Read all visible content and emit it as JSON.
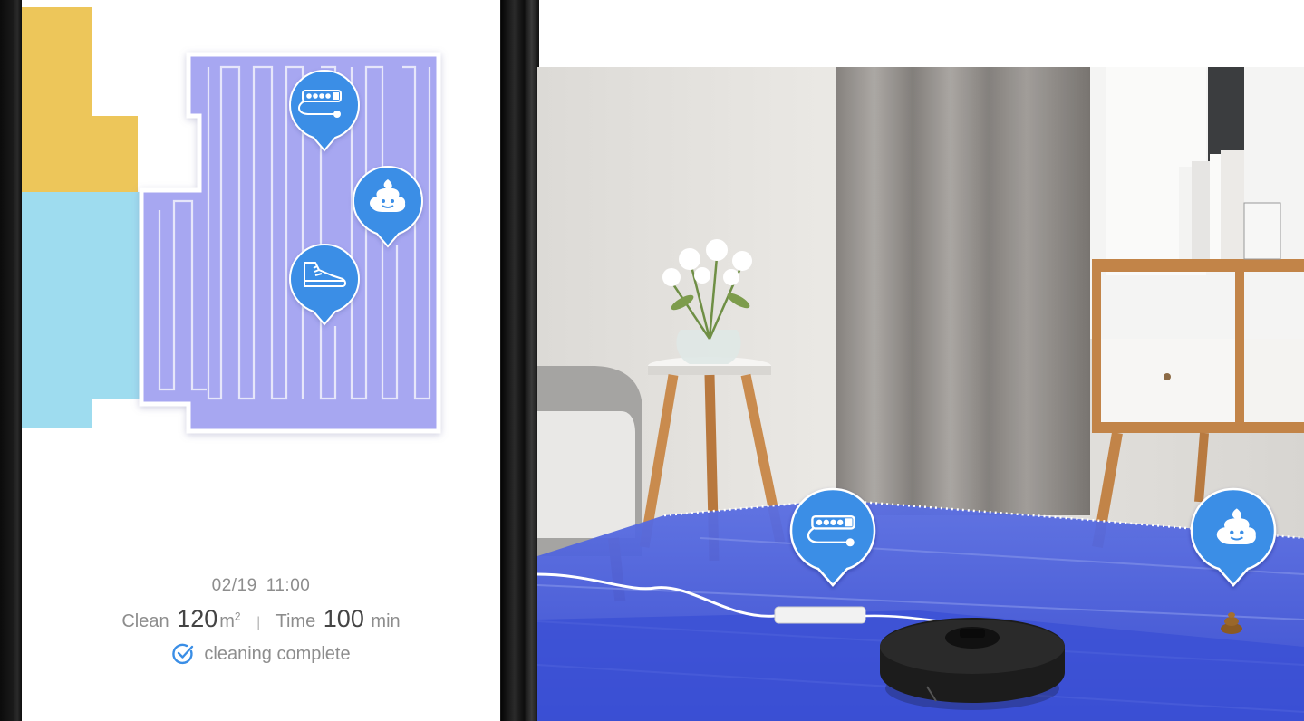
{
  "app_screen": {
    "date": "02/19",
    "time": "11:00",
    "clean_label": "Clean",
    "clean_value": "120",
    "clean_unit": "m",
    "clean_unit_sup": "2",
    "separator": "|",
    "time_label": "Time",
    "time_value": "100",
    "time_unit": "min",
    "status": "cleaning complete",
    "status_icon": "check-circle-icon"
  },
  "map_markers": [
    {
      "name": "power-strip-icon"
    },
    {
      "name": "pet-waste-icon"
    },
    {
      "name": "shoe-icon"
    }
  ],
  "ar_markers": [
    {
      "name": "power-strip-icon"
    },
    {
      "name": "pet-waste-icon"
    }
  ],
  "colors": {
    "map_room_purple": "#a7a7f1",
    "map_room_yellow": "#edc65a",
    "map_room_cyan": "#9edcef",
    "marker_blue": "#3a8ee6",
    "ar_floor_blue": "#3c53d6",
    "status_check": "#3a8ee6"
  }
}
